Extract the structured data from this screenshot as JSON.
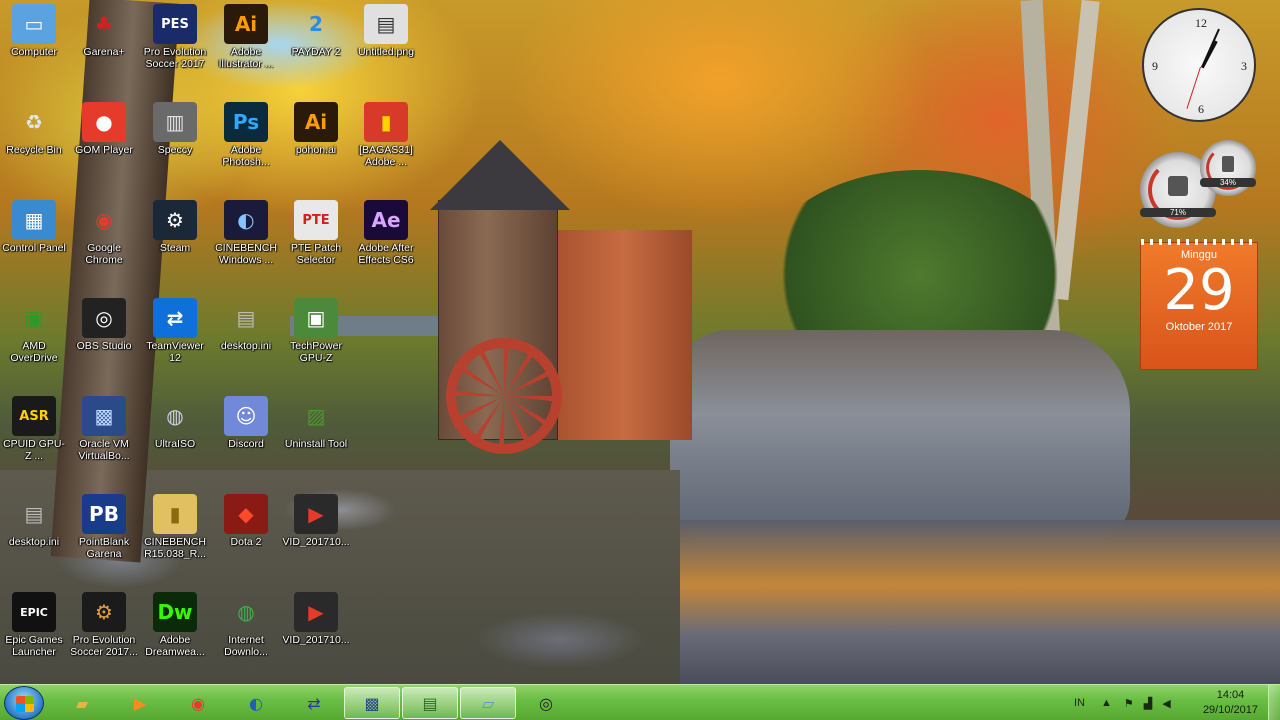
{
  "desktop": {
    "icons": [
      {
        "label": "Computer",
        "glyph": "▭",
        "bg": "#5aa2e0",
        "fg": "#ffffff"
      },
      {
        "label": "Garena+",
        "glyph": "♣",
        "bg": "transparent",
        "fg": "#d42020"
      },
      {
        "label": "Pro Evolution Soccer 2017",
        "glyph": "PES",
        "bg": "#1b2b6a",
        "fg": "#ffffff"
      },
      {
        "label": "Adobe Illustrator ...",
        "glyph": "Ai",
        "bg": "#2b1a0a",
        "fg": "#ff9a00"
      },
      {
        "label": "PAYDAY 2",
        "glyph": "2",
        "bg": "transparent",
        "fg": "#2a8ae6"
      },
      {
        "label": "Untitled.png",
        "glyph": "▤",
        "bg": "#e0e0e0",
        "fg": "#333333"
      },
      {
        "label": "Recycle Bin",
        "glyph": "♻",
        "bg": "transparent",
        "fg": "#dfe8f0"
      },
      {
        "label": "GOM Player",
        "glyph": "●",
        "bg": "#e63a2a",
        "fg": "#ffffff"
      },
      {
        "label": "Speccy",
        "glyph": "▥",
        "bg": "#6a6a6a",
        "fg": "#e0e0e0"
      },
      {
        "label": "Adobe Photosh...",
        "glyph": "Ps",
        "bg": "#0a2a3e",
        "fg": "#31a8ff"
      },
      {
        "label": "pohon.ai",
        "glyph": "Ai",
        "bg": "#2b1a0a",
        "fg": "#ff9a00"
      },
      {
        "label": "[BAGAS31] Adobe ...",
        "glyph": "▮",
        "bg": "#d83a2a",
        "fg": "#ffd200"
      },
      {
        "label": "Control Panel",
        "glyph": "▦",
        "bg": "#3a8ad0",
        "fg": "#ffffff"
      },
      {
        "label": "Google Chrome",
        "glyph": "◉",
        "bg": "transparent",
        "fg": "#e33b2e"
      },
      {
        "label": "Steam",
        "glyph": "⚙",
        "bg": "#1b2838",
        "fg": "#ffffff"
      },
      {
        "label": "CINEBENCH Windows ...",
        "glyph": "◐",
        "bg": "#1a1a3a",
        "fg": "#8ac4ff"
      },
      {
        "label": "PTE Patch Selector",
        "glyph": "PTE",
        "bg": "#e8e8e8",
        "fg": "#d02020"
      },
      {
        "label": "Adobe After Effects CS6",
        "glyph": "Ae",
        "bg": "#1a0a3a",
        "fg": "#d8a6ff"
      },
      {
        "label": "AMD OverDrive",
        "glyph": "▣",
        "bg": "transparent",
        "fg": "#2a9a2a"
      },
      {
        "label": "OBS Studio",
        "glyph": "◎",
        "bg": "#222222",
        "fg": "#ffffff"
      },
      {
        "label": "TeamViewer 12",
        "glyph": "⇄",
        "bg": "#0e70d8",
        "fg": "#ffffff"
      },
      {
        "label": "desktop.ini",
        "glyph": "▤",
        "bg": "transparent",
        "fg": "#bbbbbb"
      },
      {
        "label": "TechPower GPU-Z",
        "glyph": "▣",
        "bg": "#4a8a3a",
        "fg": "#ffffff"
      },
      {
        "label": "CPUID GPU-Z ...",
        "glyph": "ASR",
        "bg": "#1a1a1a",
        "fg": "#ffd200"
      },
      {
        "label": "Oracle VM VirtualBo...",
        "glyph": "▩",
        "bg": "#2a4a8a",
        "fg": "#bcd8ff"
      },
      {
        "label": "UltraISO",
        "glyph": "◍",
        "bg": "transparent",
        "fg": "#cfcfe0"
      },
      {
        "label": "Discord",
        "glyph": "☺",
        "bg": "#7289da",
        "fg": "#ffffff"
      },
      {
        "label": "Uninstall Tool",
        "glyph": "▨",
        "bg": "transparent",
        "fg": "#4a9a2a"
      },
      {
        "label": "desktop.ini",
        "glyph": "▤",
        "bg": "transparent",
        "fg": "#bbbbbb"
      },
      {
        "label": "PointBlank Garena",
        "glyph": "PB",
        "bg": "#1a3a8a",
        "fg": "#ffffff"
      },
      {
        "label": "CINEBENCH R15.038_R...",
        "glyph": "▮",
        "bg": "#e0c060",
        "fg": "#8a6a10"
      },
      {
        "label": "Dota 2",
        "glyph": "◆",
        "bg": "#8a1a14",
        "fg": "#ff4a2a"
      },
      {
        "label": "VID_201710...",
        "glyph": "▶",
        "bg": "#2a2a2a",
        "fg": "#e63a2a"
      },
      {
        "label": "Epic Games Launcher",
        "glyph": "EPIC",
        "bg": "#111111",
        "fg": "#ffffff"
      },
      {
        "label": "Pro Evolution Soccer 2017...",
        "glyph": "⚙",
        "bg": "#1b1b1b",
        "fg": "#e0a040"
      },
      {
        "label": "Adobe Dreamwea...",
        "glyph": "Dw",
        "bg": "#0a2a0a",
        "fg": "#35fa00"
      },
      {
        "label": "Internet Downlo...",
        "glyph": "◍",
        "bg": "transparent",
        "fg": "#3ab44a"
      },
      {
        "label": "VID_201710...",
        "glyph": "▶",
        "bg": "#2a2a2a",
        "fg": "#e63a2a"
      }
    ]
  },
  "gadgets": {
    "clock_numbers": [
      "12",
      "3",
      "6",
      "9"
    ],
    "cpu_gauge": "71%",
    "ram_gauge": "34%",
    "calendar": {
      "day": "Minggu",
      "date": "29",
      "month": "Oktober 2017"
    }
  },
  "taskbar": {
    "pinned": [
      {
        "name": "explorer",
        "glyph": "▰",
        "color": "#e8b640"
      },
      {
        "name": "media-player",
        "glyph": "▶",
        "color": "#ff8a1a"
      },
      {
        "name": "chrome",
        "glyph": "◉",
        "color": "#e33b2e"
      },
      {
        "name": "steam-like",
        "glyph": "◐",
        "color": "#1f5fb8"
      },
      {
        "name": "network-tool",
        "glyph": "⇄",
        "color": "#2a3a9a"
      },
      {
        "name": "virtualbox",
        "glyph": "▩",
        "color": "#2a4a8a"
      },
      {
        "name": "gpu-monitor",
        "glyph": "▤",
        "color": "#2a6a2a"
      },
      {
        "name": "generic-window",
        "glyph": "▱",
        "color": "#4a9ad0"
      },
      {
        "name": "obs",
        "glyph": "◎",
        "color": "#222222"
      }
    ],
    "language": "IN",
    "time": "14:04",
    "date": "29/10/2017"
  }
}
